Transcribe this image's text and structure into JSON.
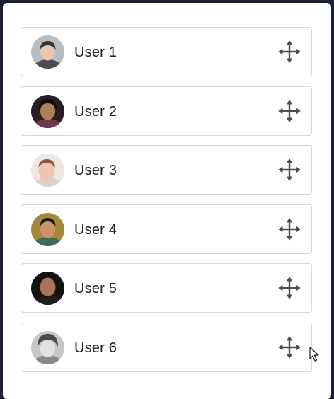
{
  "users": [
    {
      "name": "User 1",
      "avatar_bg": "#b9bcc3",
      "skin": "#e8c6b2",
      "hair": "#3b3532",
      "shirt": "#4a4d55"
    },
    {
      "name": "User 2",
      "avatar_bg": "#2a1d24",
      "skin": "#b07e60",
      "hair": "#140d0e",
      "shirt": "#6a3a4a"
    },
    {
      "name": "User 3",
      "avatar_bg": "#efe6e0",
      "skin": "#f0c4b0",
      "hair": "#8a5a44",
      "shirt": "#d8d2ce"
    },
    {
      "name": "User 4",
      "avatar_bg": "#a48a38",
      "skin": "#c9936b",
      "hair": "#1e1814",
      "shirt": "#3f6a5a"
    },
    {
      "name": "User 5",
      "avatar_bg": "#141212",
      "skin": "#a8745a",
      "hair": "#1a1413",
      "shirt": "#1f1d1d"
    },
    {
      "name": "User 6",
      "avatar_bg": "#c7c7c7",
      "skin": "#e2e2e2",
      "hair": "#4a4a4a",
      "shirt": "#8a8a8a"
    }
  ],
  "icons": {
    "drag_handle": "move-arrows-icon",
    "pointer": "mouse-cursor-icon"
  }
}
